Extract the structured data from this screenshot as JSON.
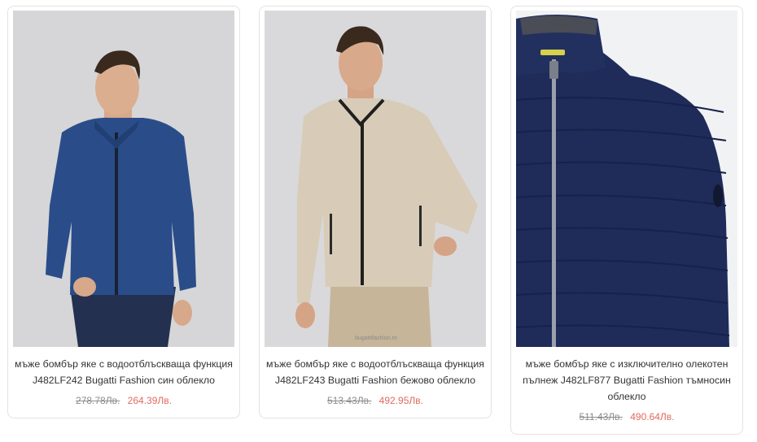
{
  "products": [
    {
      "title": "мъже бомбър яке с водоотблъскваща функция J482LF242 Bugatti Fashion син облекло",
      "old_price": "278.78Лв.",
      "new_price": "264.39Лв.",
      "image_icon": "blue-bomber-jacket-photo",
      "watermark": ""
    },
    {
      "title": "мъже бомбър яке с водоотблъскваща функция J482LF243 Bugatti Fashion бежово облекло",
      "old_price": "513.43Лв.",
      "new_price": "492.95Лв.",
      "image_icon": "beige-bomber-jacket-photo",
      "watermark": "bugattifashion.ro"
    },
    {
      "title": "мъже бомбър яке с изключително олекотен пълнеж J482LF877 Bugatti Fashion тъмносин облекло",
      "old_price": "511.43Лв.",
      "new_price": "490.64Лв.",
      "image_icon": "navy-puffer-jacket-closeup-photo",
      "watermark": ""
    }
  ],
  "colors": {
    "sale_price": "#e06a5f",
    "old_price": "#8c8c8c",
    "text": "#333333",
    "card_border": "#e3e3e3"
  }
}
